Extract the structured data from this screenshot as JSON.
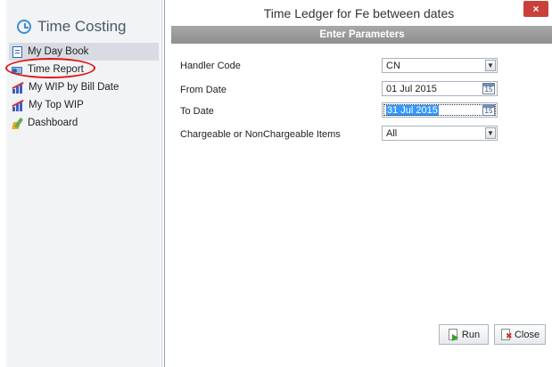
{
  "sidebar": {
    "app_title": "Time Costing",
    "items": [
      {
        "label": "My Day Book",
        "icon": "book-icon",
        "active": true
      },
      {
        "label": "Time Report",
        "icon": "report-icon",
        "active": false
      },
      {
        "label": "My WIP by Bill Date",
        "icon": "bar-chart-icon",
        "active": false
      },
      {
        "label": "My Top WIP",
        "icon": "bar-chart-icon",
        "active": false
      },
      {
        "label": "Dashboard",
        "icon": "dashboard-icon",
        "active": false
      }
    ],
    "highlighted_item": "Time Report",
    "highlight_color": "#e01515"
  },
  "dialog": {
    "title": "Time Ledger for Fe between dates",
    "close_glyph": "×",
    "section_header": "Enter Parameters",
    "fields": {
      "handler_code": {
        "label": "Handler Code",
        "value": "CN"
      },
      "from_date": {
        "label": "From Date",
        "value": "01 Jul 2015",
        "calendar_day": "15"
      },
      "to_date": {
        "label": "To Date",
        "value": "31 Jul 2015",
        "calendar_day": "15"
      },
      "chargeable": {
        "label": "Chargeable or NonChargeable Items",
        "value": "All"
      }
    },
    "buttons": {
      "run": "Run",
      "close": "Close"
    },
    "colors": {
      "header_bg": "#969696",
      "close_button_bg": "#c9403a",
      "selection": "#3399ff"
    }
  }
}
